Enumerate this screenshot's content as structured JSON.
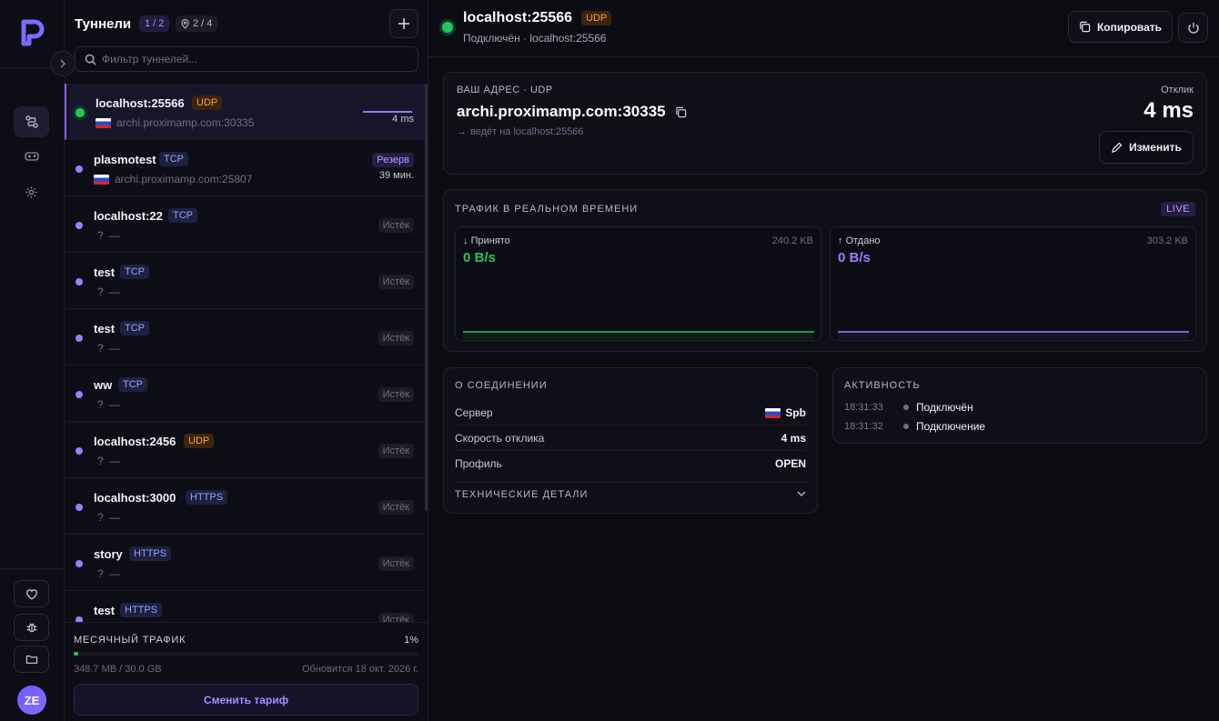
{
  "sidebar": {
    "collapse_icon": "chevron-right-icon",
    "nav": [
      "tunnels-icon",
      "gamepad-icon",
      "gear-icon"
    ],
    "bottom": [
      "heart-icon",
      "bug-icon",
      "folder-icon"
    ],
    "avatar": "ZE"
  },
  "tunnels": {
    "title": "Туннели",
    "count_active": "1 / 2",
    "count_locations": "2 / 4",
    "search_placeholder": "Фильтр туннелей...",
    "items": [
      {
        "name": "localhost:25566",
        "protocol": "UDP",
        "address": "archi.proximamp.com:30335",
        "status": "4 ms",
        "selected": true
      },
      {
        "name": "plasmotest",
        "protocol": "TCP",
        "address": "archi.proximamp.com:25807",
        "badge": "Резерв",
        "status": "39 мин."
      },
      {
        "name": "localhost:22",
        "protocol": "TCP",
        "address": "?",
        "dash": "—",
        "badge": "Истёк"
      },
      {
        "name": "test",
        "protocol": "TCP",
        "address": "?",
        "dash": "—",
        "badge": "Истёк"
      },
      {
        "name": "test",
        "protocol": "TCP",
        "address": "?",
        "dash": "—",
        "badge": "Истёк"
      },
      {
        "name": "ww",
        "protocol": "TCP",
        "address": "?",
        "dash": "—",
        "badge": "Истёк"
      },
      {
        "name": "localhost:2456",
        "protocol": "UDP",
        "address": "?",
        "dash": "—",
        "badge": "Истёк"
      },
      {
        "name": "localhost:3000",
        "protocol": "HTTPS",
        "address": "?",
        "dash": "—",
        "badge": "Истёк"
      },
      {
        "name": "story",
        "protocol": "HTTPS",
        "address": "?",
        "dash": "—",
        "badge": "Истёк"
      },
      {
        "name": "test",
        "protocol": "HTTPS",
        "address": "?",
        "dash": "—",
        "badge": "Истёк"
      }
    ]
  },
  "traffic": {
    "label": "МЕСЯЧНЫЙ ТРАФИК",
    "percent": "1%",
    "used": "348.7 MB / 30.0 GB",
    "renew": "Обновится 18 окт. 2026 г.",
    "plan_button": "Сменить тариф",
    "fill_fraction": 0.012
  },
  "header": {
    "title": "localhost:25566",
    "protocol": "UDP",
    "subtitle": "Подключён · localhost:25566",
    "copy_label": "Копировать"
  },
  "address_card": {
    "label": "ВАШ АДРЕС · UDP",
    "address": "archi.proximamp.com:30335",
    "forward": "ведёт на localhost:25566",
    "latency_label": "Отклик",
    "latency_value": "4 ms",
    "edit_label": "Изменить"
  },
  "live": {
    "label": "ТРАФИК В РЕАЛЬНОМ ВРЕМЕНИ",
    "badge": "LIVE",
    "received": {
      "label": "Принято",
      "total": "240.2 KB",
      "rate": "0 B/s"
    },
    "sent": {
      "label": "Отдано",
      "total": "303.2 KB",
      "rate": "0 B/s"
    }
  },
  "connection": {
    "label": "О СОЕДИНЕНИИ",
    "rows": [
      {
        "key": "Сервер",
        "value": "Spb",
        "flag": true
      },
      {
        "key": "Скорость отклика",
        "value": "4 ms"
      },
      {
        "key": "Профиль",
        "value": "OPEN"
      }
    ],
    "tech": "ТЕХНИЧЕСКИЕ ДЕТАЛИ"
  },
  "activity": {
    "label": "АКТИВНОСТЬ",
    "events": [
      {
        "time": "18:31:33",
        "text": "Подключён"
      },
      {
        "time": "18:31:32",
        "text": "Подключение"
      }
    ]
  },
  "colors": {
    "accent": "#8b5cf6",
    "online": "#22c55e",
    "udp": "#f59e42",
    "tcp": "#8ea2ff"
  }
}
